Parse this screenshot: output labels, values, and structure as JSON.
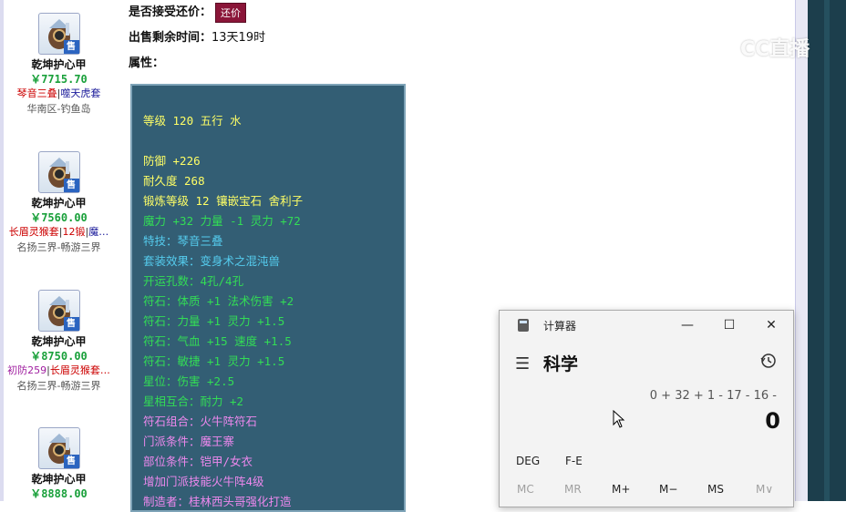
{
  "listing": {
    "items": [
      {
        "name": "乾坤护心甲",
        "price": "￥7715.70",
        "tag1": "琴音三叠",
        "sep": "|",
        "tag2": "噬天虎套",
        "server": "华南区-钓鱼岛",
        "badge": "售"
      },
      {
        "name": "乾坤护心甲",
        "price": "￥7560.00",
        "tag1": "长眉灵猴套",
        "sep": "|",
        "tag2": "12锻",
        "sep2": "|",
        "tag3": "魔…",
        "server": "名扬三界-畅游三界",
        "badge": "售"
      },
      {
        "name": "乾坤护心甲",
        "price": "￥8750.00",
        "tag1": "初防259",
        "sep": "|",
        "tag2": "长眉灵猴套…",
        "server": "名扬三界-畅游三界",
        "badge": "售"
      },
      {
        "name": "乾坤护心甲",
        "price": "￥8888.00",
        "badge": "售"
      }
    ]
  },
  "detail": {
    "counter_offer_label": "是否接受还价：",
    "counter_offer_button": "还价",
    "time_left_label": "出售剩余时间：",
    "time_left_value": "13天19时",
    "attributes_label": "属性：",
    "attributes": [
      {
        "text": "等级 120 五行 水",
        "color": "yellow"
      },
      {
        "text": "",
        "color": "yellow"
      },
      {
        "text": "防御 +226",
        "color": "yellow"
      },
      {
        "text": "耐久度 268",
        "color": "yellow"
      },
      {
        "text": "锻炼等级 12 镶嵌宝石 舍利子",
        "color": "yellow"
      },
      {
        "text": "魔力 +32 力量 -1 灵力 +72",
        "color": "green"
      },
      {
        "text": "特技：琴音三叠",
        "color": "cyan"
      },
      {
        "text": "套装效果：变身术之混沌兽",
        "color": "cyan"
      },
      {
        "text": "开运孔数：4孔/4孔",
        "color": "green"
      },
      {
        "text": "符石：体质 +1 法术伤害 +2",
        "color": "green"
      },
      {
        "text": "符石：力量 +1 灵力 +1.5",
        "color": "green"
      },
      {
        "text": "符石：气血 +15 速度 +1.5",
        "color": "green"
      },
      {
        "text": "符石：敏捷 +1 灵力 +1.5",
        "color": "green"
      },
      {
        "text": "星位：伤害 +2.5",
        "color": "green"
      },
      {
        "text": "星相互合：耐力 +2",
        "color": "green"
      },
      {
        "text": "符石组合：火牛阵符石",
        "color": "pink"
      },
      {
        "text": "门派条件：魔王寨",
        "color": "pink"
      },
      {
        "text": "部位条件：铠甲/女衣",
        "color": "pink"
      },
      {
        "text": "增加门派技能火牛阵4级",
        "color": "pink"
      },
      {
        "text": "制造者：桂林西头哥强化打造",
        "color": "pink"
      }
    ]
  },
  "watermark": {
    "text": "CC直播"
  },
  "calculator": {
    "title": "计算器",
    "mode": "科学",
    "expression": "0 + 32 + 1 - 17 - 16 -",
    "result": "0",
    "deg_label": "DEG",
    "fe_label": "F-E",
    "memory_buttons": [
      "MC",
      "MR",
      "M+",
      "M−",
      "MS",
      "M∨"
    ],
    "window_buttons": {
      "minimize": "—",
      "maximize": "☐",
      "close": "✕"
    }
  },
  "colors": {
    "attr_bg": "#335e74",
    "yellow": "#ffff66",
    "green": "#33dd55",
    "cyan": "#55ccee",
    "pink": "#ee88ee",
    "price": "#19a03a",
    "counter_button": "#8a1538"
  }
}
